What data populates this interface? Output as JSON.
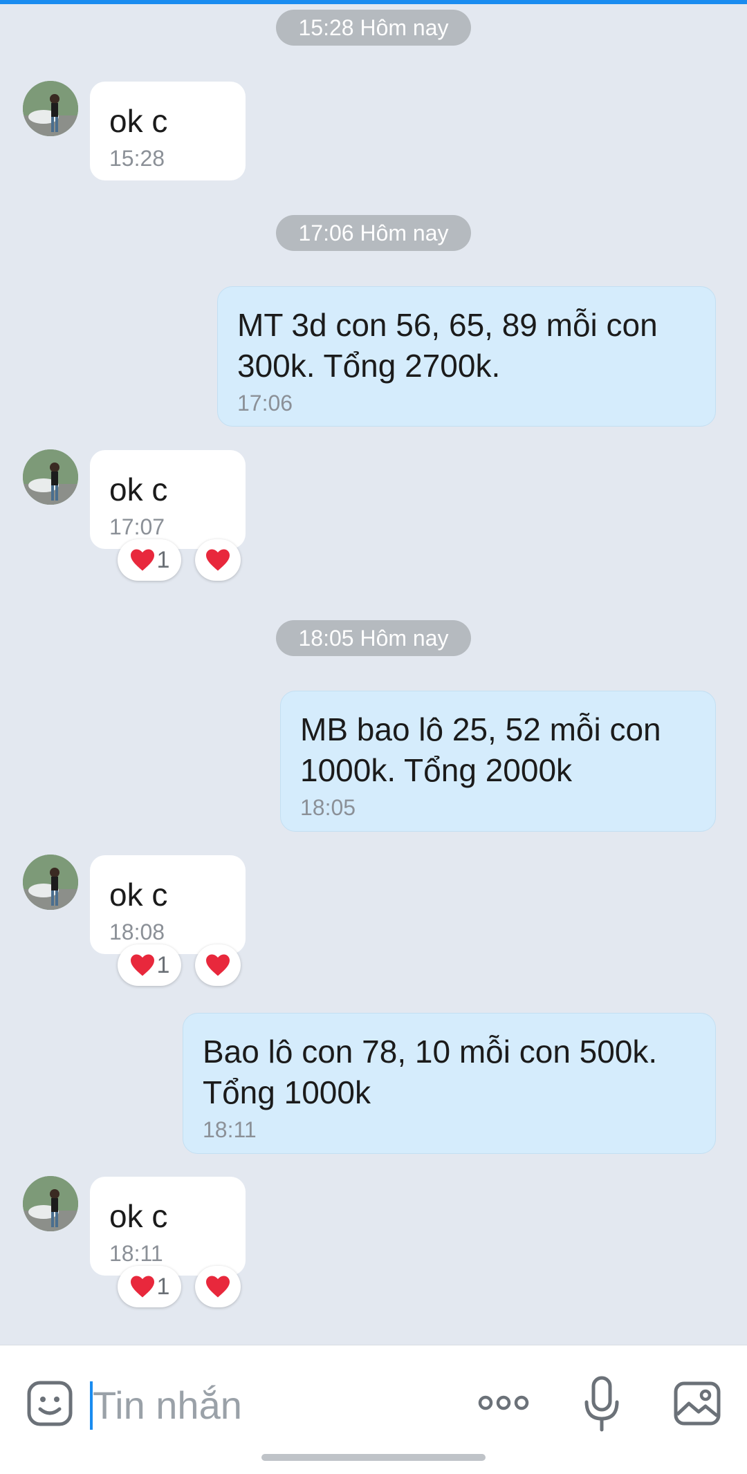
{
  "theme": {
    "background": "#e3e8f0",
    "outgoing_bubble": "#d5ecfc",
    "incoming_bubble": "#ffffff",
    "timestamp_pill": "#b5babf",
    "accent": "#1a8cf0",
    "reaction_heart": "#e8283c"
  },
  "conversation": {
    "separators": [
      "15:28 Hôm nay",
      "17:06 Hôm nay",
      "18:05 Hôm nay"
    ],
    "messages": [
      {
        "direction": "incoming",
        "text": "ok c",
        "time": "15:28"
      },
      {
        "direction": "outgoing",
        "text": "MT 3d con 56, 65, 89 mỗi con 300k. Tổng 2700k.",
        "time": "17:06"
      },
      {
        "direction": "incoming",
        "text": "ok c",
        "time": "17:07",
        "reactions": {
          "icon": "heart-icon",
          "count": "1",
          "my_reaction": "heart-icon"
        }
      },
      {
        "direction": "outgoing",
        "text": "MB bao lô 25, 52 mỗi con 1000k. Tổng 2000k",
        "time": "18:05"
      },
      {
        "direction": "incoming",
        "text": "ok c",
        "time": "18:08",
        "reactions": {
          "icon": "heart-icon",
          "count": "1",
          "my_reaction": "heart-icon"
        }
      },
      {
        "direction": "outgoing",
        "text": "Bao lô con 78, 10 mỗi con 500k. Tổng 1000k",
        "time": "18:11"
      },
      {
        "direction": "incoming",
        "text": "ok c",
        "time": "18:11",
        "reactions": {
          "icon": "heart-icon",
          "count": "1",
          "my_reaction": "heart-icon"
        }
      }
    ]
  },
  "composer": {
    "placeholder": "Tin nhắn",
    "value": "",
    "icons": [
      "sticker-icon",
      "more-options-icon",
      "microphone-icon",
      "image-gallery-icon"
    ]
  }
}
